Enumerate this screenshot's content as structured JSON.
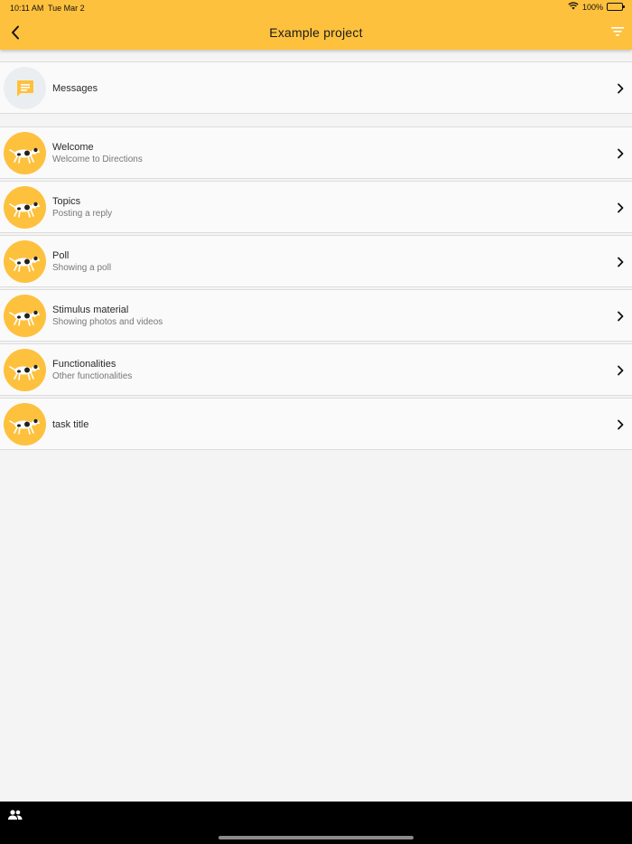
{
  "status_bar": {
    "time": "10:11 AM",
    "date": "Tue Mar 2",
    "battery": "100%"
  },
  "header": {
    "title": "Example project",
    "back_icon": "chevron-left-icon",
    "filter_icon": "filter-icon"
  },
  "colors": {
    "accent": "#fec13e",
    "background": "#f4f4f4",
    "row": "#fafafa",
    "bottom_bar": "#000000"
  },
  "messages": {
    "label": "Messages",
    "icon": "chat-bubble-icon"
  },
  "tasks": [
    {
      "title": "Welcome",
      "subtitle": "Welcome to Directions"
    },
    {
      "title": "Topics",
      "subtitle": "Posting a reply"
    },
    {
      "title": "Poll",
      "subtitle": "Showing a poll"
    },
    {
      "title": "Stimulus material",
      "subtitle": "Showing photos and videos"
    },
    {
      "title": "Functionalities",
      "subtitle": "Other functionalities"
    },
    {
      "title": "task title",
      "subtitle": ""
    }
  ],
  "bottom_bar": {
    "icon": "people-icon"
  }
}
